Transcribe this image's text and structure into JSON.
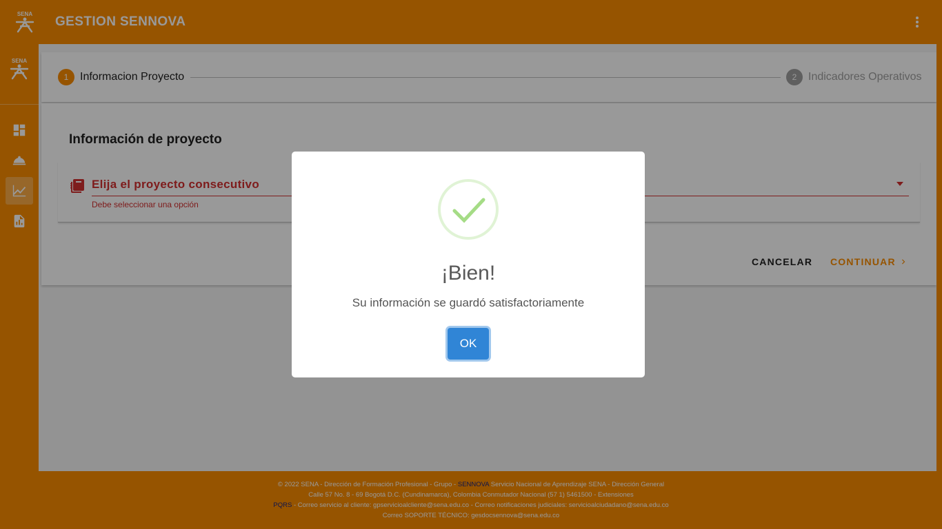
{
  "app": {
    "title": "GESTION SENNOVA"
  },
  "colors": {
    "brand": "#fb8c00",
    "error": "#d32f2f",
    "confirm": "#3085d6",
    "success": "#a5dc86"
  },
  "sidenav": {
    "items": [
      {
        "name": "dashboard",
        "icon": "dashboard-icon",
        "active": false
      },
      {
        "name": "project",
        "icon": "bell-dome-icon",
        "active": false
      },
      {
        "name": "indicators",
        "icon": "chart-line-icon",
        "active": true
      },
      {
        "name": "reports",
        "icon": "file-chart-icon",
        "active": false
      }
    ]
  },
  "stepper": {
    "steps": [
      {
        "number": "1",
        "label": "Informacion Proyecto",
        "active": true
      },
      {
        "number": "2",
        "label": "Indicadores Operativos",
        "active": false
      }
    ]
  },
  "form": {
    "heading": "Información de proyecto",
    "select_label": "Elija el proyecto consecutivo",
    "error": "Debe seleccionar una opción",
    "cancel": "CANCELAR",
    "continue": "CONTINUAR"
  },
  "footer": {
    "line1_pre": "© 2022 SENA - Dirección de Formación Profesional - Grupo - ",
    "line1_hl": "SENNOVA",
    "line1_post": " Servicio Nacional de Aprendizaje SENA - Dirección General",
    "line2": "Calle 57 No. 8 - 69 Bogotá D.C. (Cundinamarca), Colombia Conmutador Nacional (57 1) 5461500 - Extensiones",
    "line3_hl": "PQRS",
    "line3_post": " - Correo servicio al cliente: gpservicioalcliente@sena.edu.co - Correo notificaciones judiciales: servicioalciudadano@sena.edu.co",
    "line4": "Correo SOPORTE TÉCNICO: gesdocsennova@sena.edu.co"
  },
  "dialog": {
    "icon": "success-check-icon",
    "title": "¡Bien!",
    "text": "Su información se guardó satisfactoriamente",
    "ok": "OK"
  }
}
